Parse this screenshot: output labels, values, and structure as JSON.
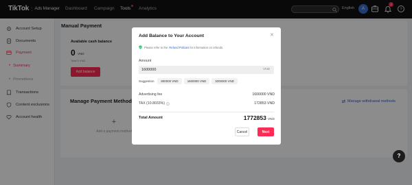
{
  "header": {
    "logo": "TikTok",
    "logo_sub": "Ads Manager",
    "nav": [
      "Dashboard",
      "Campaign",
      "Tools",
      "Analytics"
    ],
    "active_nav": "Tools",
    "language": "English",
    "avatar_initial": "A",
    "notification_count": "3",
    "icons": [
      "search-icon",
      "briefcase-icon",
      "bell-icon",
      "help-icon"
    ]
  },
  "sidebar": {
    "items": [
      {
        "label": "Account Setup",
        "icon": "gear-icon"
      },
      {
        "label": "Documents",
        "icon": "document-icon"
      },
      {
        "label": "Payment",
        "icon": "card-icon"
      },
      {
        "label": "Summary",
        "icon": "bullet"
      },
      {
        "label": "Promotions",
        "icon": "bullet"
      },
      {
        "label": "Transactions",
        "icon": "receipt-icon"
      },
      {
        "label": "Content exclusions",
        "icon": "shield-icon"
      },
      {
        "label": "Account health",
        "icon": "heart-icon"
      }
    ]
  },
  "main": {
    "manual_payment_title": "Manual Payment",
    "available_label": "Available cash balance",
    "available_amount": "0",
    "available_unit": "VND",
    "total_label": "Total 0 VND",
    "add_balance_button": "Add balance",
    "payment_methods_title": "Manage Payment Methods",
    "manage_withdrawal_link": "Manage withdrawal methods",
    "add_payment_method": "Add a payment method"
  },
  "modal": {
    "title": "Add Balance to Your Account",
    "notice_pre": "Please refer to the",
    "notice_link": "Refund Policies",
    "notice_post": "for information on refunds.",
    "amount_label": "Amount",
    "amount_value": "1600000",
    "amount_unit": "VND",
    "suggestion_label": "Suggestion",
    "suggestions": [
      "800000 VND",
      "1600000 VND",
      "3200000 VND"
    ],
    "advertising_fee_label": "Advertising fee",
    "advertising_fee_value": "1600000 VND",
    "tax_label": "TAX (10.8033%)",
    "tax_value": "172853 VND",
    "total_label": "Total Amount",
    "total_value": "1772853",
    "total_unit": "VND",
    "cancel_button": "Cancel",
    "next_button": "Next"
  },
  "help_button": "?",
  "colors": {
    "accent": "#fe2c55",
    "topbar": "#121212",
    "link": "#3a62b8"
  }
}
